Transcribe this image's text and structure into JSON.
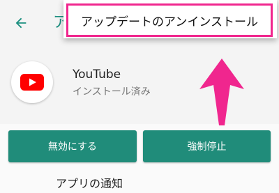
{
  "appbar": {
    "title_partial": "ア"
  },
  "app": {
    "name": "YouTube",
    "status": "インストール済み"
  },
  "buttons": {
    "disable_label": "無効にする",
    "force_stop_label": "強制停止"
  },
  "sections": {
    "notifications_label": "アプリの通知"
  },
  "overflow_menu": {
    "uninstall_updates_label": "アップデートのアンインストール"
  },
  "icons": {
    "back": "arrow-left-icon",
    "youtube": "youtube-logo-icon",
    "annotation": "up-arrow-annotation"
  },
  "colors": {
    "accent": "#1b8f7f",
    "button": "#208c7a",
    "highlight": "#f0268e",
    "youtube_red": "#ff0000"
  }
}
